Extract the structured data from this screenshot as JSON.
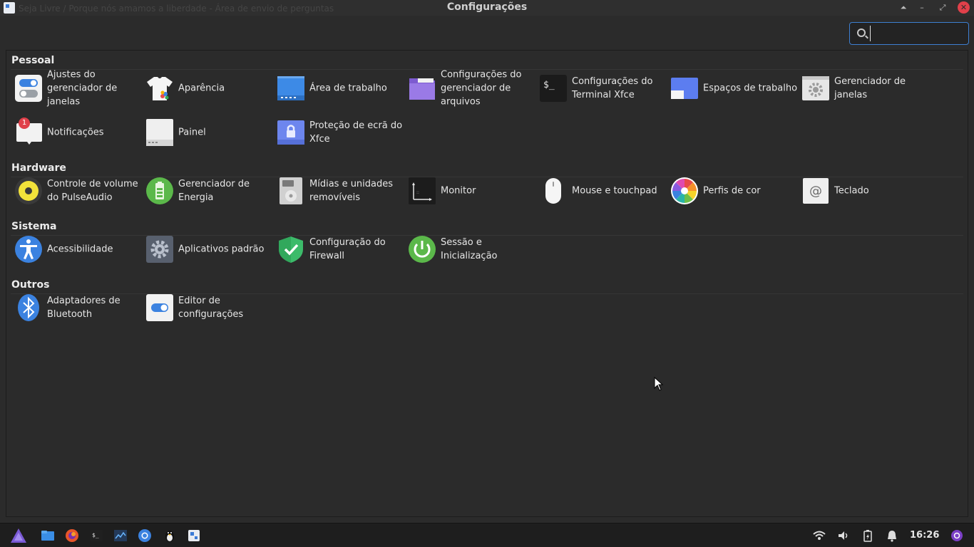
{
  "window": {
    "title": "Configurações",
    "ghost_text": "Seja Livre / Porque nós amamos a liberdade - Área de envio de perguntas"
  },
  "window_buttons": {
    "up": "⏶",
    "minimize": "–",
    "maximize": "⤢",
    "close": "✕"
  },
  "search": {
    "value": "",
    "placeholder": ""
  },
  "sections": [
    {
      "title": "Pessoal",
      "items": [
        {
          "label": "Ajustes do gerenciador de janelas",
          "icon": "toggle-switches-icon"
        },
        {
          "label": "Aparência",
          "icon": "tshirt-icon"
        },
        {
          "label": "Área de trabalho",
          "icon": "desktop-icon"
        },
        {
          "label": "Configurações do gerenciador de arquivos",
          "icon": "folder-icon"
        },
        {
          "label": "Configurações do Terminal Xfce",
          "icon": "terminal-icon"
        },
        {
          "label": "Espaços de trabalho",
          "icon": "workspaces-icon"
        },
        {
          "label": "Gerenciador de janelas",
          "icon": "window-gear-icon"
        },
        {
          "label": "Notificações",
          "icon": "notification-icon",
          "badge": "1"
        },
        {
          "label": "Painel",
          "icon": "panel-icon"
        },
        {
          "label": "Proteção de ecrã do Xfce",
          "icon": "screensaver-lock-icon"
        }
      ]
    },
    {
      "title": "Hardware",
      "items": [
        {
          "label": "Controle de volume do PulseAudio",
          "icon": "speaker-icon"
        },
        {
          "label": "Gerenciador de Energia",
          "icon": "battery-icon"
        },
        {
          "label": "Mídias e unidades removíveis",
          "icon": "drive-icon"
        },
        {
          "label": "Monitor",
          "icon": "monitor-icon"
        },
        {
          "label": "Mouse e touchpad",
          "icon": "mouse-icon"
        },
        {
          "label": "Perfis de cor",
          "icon": "color-wheel-icon"
        },
        {
          "label": "Teclado",
          "icon": "keyboard-at-icon"
        }
      ]
    },
    {
      "title": "Sistema",
      "items": [
        {
          "label": "Acessibilidade",
          "icon": "accessibility-icon"
        },
        {
          "label": "Aplicativos padrão",
          "icon": "gear-icon"
        },
        {
          "label": "Configuração do Firewall",
          "icon": "shield-check-icon"
        },
        {
          "label": "Sessão e Inicialização",
          "icon": "power-icon"
        }
      ]
    },
    {
      "title": "Outros",
      "items": [
        {
          "label": "Adaptadores de Bluetooth",
          "icon": "bluetooth-icon"
        },
        {
          "label": "Editor de configurações",
          "icon": "settings-editor-icon"
        }
      ]
    }
  ],
  "taskbar": {
    "launchers": [
      "menu-icon",
      "files-icon",
      "firefox-icon",
      "terminal-icon",
      "monitor-app-icon",
      "browser-icon",
      "tux-icon",
      "settings-app-icon"
    ],
    "tray": [
      "wifi-icon",
      "volume-icon",
      "battery-icon",
      "bell-icon"
    ],
    "clock": "16:26"
  },
  "colors": {
    "accent": "#3d7fd1",
    "close": "#e0404a",
    "background": "#2b2b2b"
  }
}
